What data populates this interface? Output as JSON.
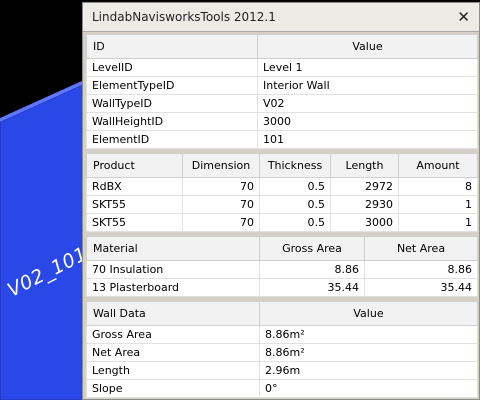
{
  "viewport": {
    "wall_label": "V02_101",
    "wall_color": "#2a48e8"
  },
  "panel": {
    "title": "LindabNavisworksTools 2012.1",
    "close_glyph": "✕"
  },
  "properties": {
    "headers": [
      "ID",
      "Value"
    ],
    "rows": [
      [
        "LevelID",
        "Level 1"
      ],
      [
        "ElementTypeID",
        "Interior Wall"
      ],
      [
        "WallTypeID",
        "V02"
      ],
      [
        "WallHeightID",
        "3000"
      ],
      [
        "ElementID",
        "101"
      ]
    ]
  },
  "products": {
    "headers": [
      "Product",
      "Dimension",
      "Thickness",
      "Length",
      "Amount"
    ],
    "rows": [
      [
        "RdBX",
        "70",
        "0.5",
        "2972",
        "8"
      ],
      [
        "SKT55",
        "70",
        "0.5",
        "2930",
        "1"
      ],
      [
        "SKT55",
        "70",
        "0.5",
        "3000",
        "1"
      ]
    ]
  },
  "materials": {
    "headers": [
      "Material",
      "Gross Area",
      "Net Area"
    ],
    "rows": [
      [
        "70 Insulation",
        "8.86",
        "8.86"
      ],
      [
        "13 Plasterboard",
        "35.44",
        "35.44"
      ]
    ]
  },
  "wall_data": {
    "headers": [
      "Wall Data",
      "Value"
    ],
    "rows": [
      [
        "Gross Area",
        "8.86m²"
      ],
      [
        "Net Area",
        "8.86m²"
      ],
      [
        "Length",
        "2.96m"
      ],
      [
        "Slope",
        "0°"
      ]
    ]
  }
}
